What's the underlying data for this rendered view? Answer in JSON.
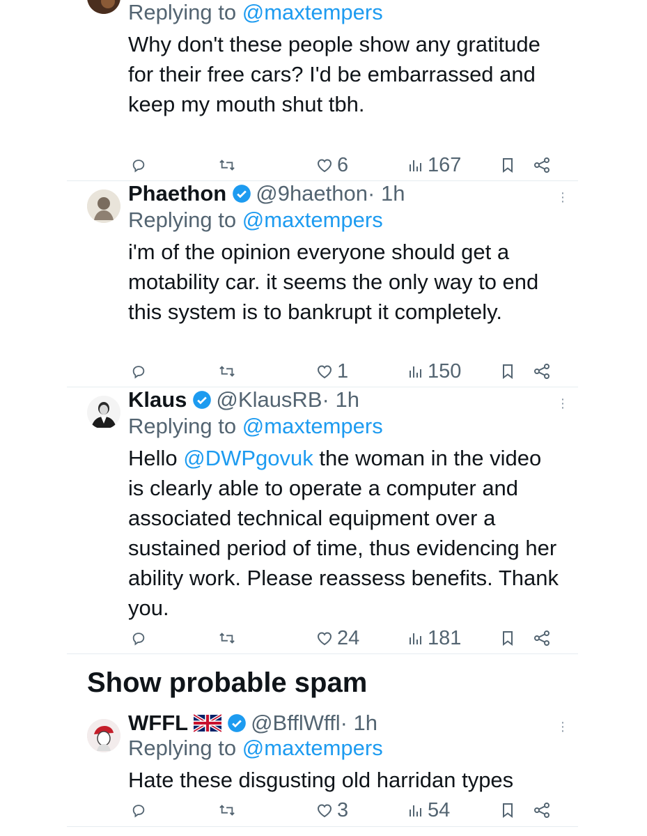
{
  "replying_label": "Replying to",
  "tweets": [
    {
      "reply_to": "@maxtempers",
      "text": "Why don't these people show any gratitude for their free cars? I'd be embarrassed and keep my mouth shut tbh.",
      "likes": "6",
      "views": "167"
    },
    {
      "name": "Phaethon",
      "handle": "@9haethon",
      "time": "· 1h",
      "reply_to": "@maxtempers",
      "text": "i'm of the opinion everyone should get a motability car. it seems the only way to end this system is to bankrupt it completely.",
      "likes": "1",
      "views": "150"
    },
    {
      "name": "Klaus",
      "handle": "@KlausRB",
      "time": "· 1h",
      "reply_to": "@maxtempers",
      "text_prefix": "Hello ",
      "mention": "@DWPgovuk",
      "text": " the woman in the video is clearly able to operate a computer and associated technical equipment over a sustained period of time, thus evidencing her ability work. Please reassess benefits. Thank you.",
      "likes": "24",
      "views": "181"
    },
    {
      "name": "WFFL",
      "flag": "🇬🇧",
      "handle": "@BfflWffl",
      "time": "· 1h",
      "reply_to": "@maxtempers",
      "text": "Hate these disgusting old harridan types",
      "likes": "3",
      "views": "54"
    }
  ],
  "spam_heading": "Show probable spam",
  "colors": {
    "accent": "#1d9bf0",
    "secondary_text": "#536471",
    "divider": "#e6ecf0"
  },
  "icons": [
    "reply-icon",
    "retweet-icon",
    "like-icon",
    "views-icon",
    "bookmark-icon",
    "share-icon",
    "verified-icon",
    "more-icon"
  ]
}
